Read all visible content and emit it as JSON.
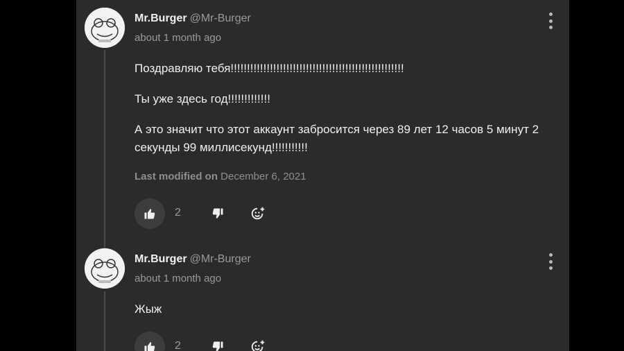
{
  "comments": [
    {
      "author": "Mr.Burger",
      "handle": "@Mr-Burger",
      "time": "about 1 month ago",
      "paragraphs": [
        "Поздравляю тебя!!!!!!!!!!!!!!!!!!!!!!!!!!!!!!!!!!!!!!!!!!!!!!!!!!!!!",
        "Ты уже здесь год!!!!!!!!!!!!!",
        "А это значит что этот аккаунт забросится через 89 лет 12 часов 5 минут 2 секунды 99 миллисекунд!!!!!!!!!!!"
      ],
      "modified_label": "Last modified on",
      "modified_date": "December 6, 2021",
      "like_count": "2"
    },
    {
      "author": "Mr.Burger",
      "handle": "@Mr-Burger",
      "time": "about 1 month ago",
      "paragraphs": [
        "Жыж"
      ],
      "like_count": "2"
    }
  ],
  "icons": {
    "like": "thumbs-up-icon",
    "dislike": "thumbs-down-icon",
    "react": "add-reaction-icon",
    "more": "more-vertical-icon"
  },
  "colors": {
    "background": "#000000",
    "panel": "#2b2b2b",
    "text": "#f0f0f0",
    "muted": "#9a9a9a"
  }
}
